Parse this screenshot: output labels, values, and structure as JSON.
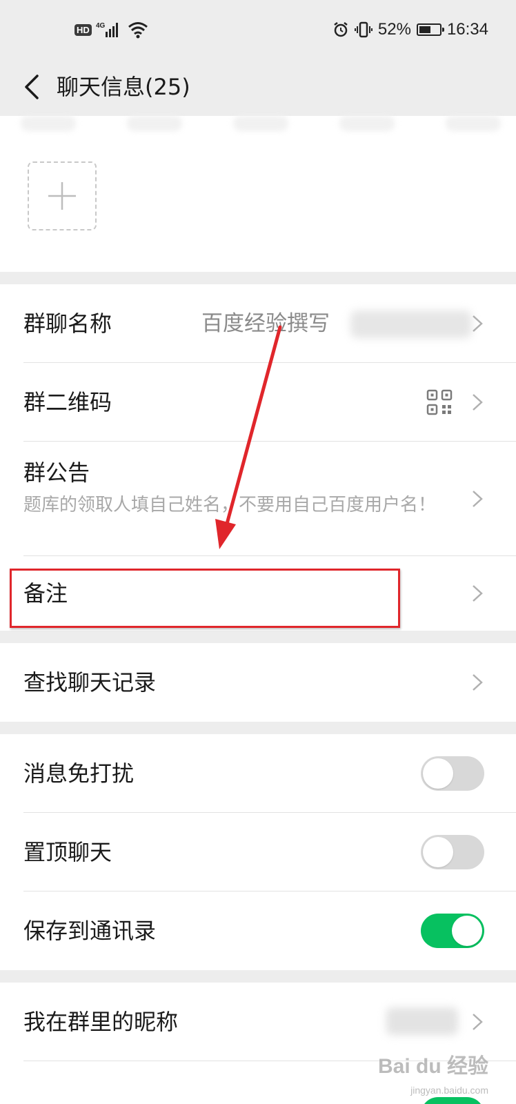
{
  "status_bar": {
    "hd": "HD",
    "network": "4G",
    "battery": "52%",
    "time": "16:34"
  },
  "nav": {
    "title": "聊天信息(25)"
  },
  "settings": {
    "group_name_label": "群聊名称",
    "group_name_value": "百度经验撰写",
    "qr_label": "群二维码",
    "notice_label": "群公告",
    "notice_text": "题库的领取人填自己姓名，不要用自己百度用户名！",
    "remark_label": "备注",
    "search_history_label": "查找聊天记录",
    "mute_label": "消息免打扰",
    "pin_label": "置顶聊天",
    "save_contacts_label": "保存到通讯录",
    "nickname_label": "我在群里的昵称"
  },
  "toggles": {
    "mute": false,
    "pin": false,
    "save_contacts": true
  },
  "colors": {
    "accent_green": "#07c160",
    "annotation_red": "#e0262b"
  },
  "watermark": {
    "main": "Bai du 经验",
    "sub": "jingyan.baidu.com"
  }
}
